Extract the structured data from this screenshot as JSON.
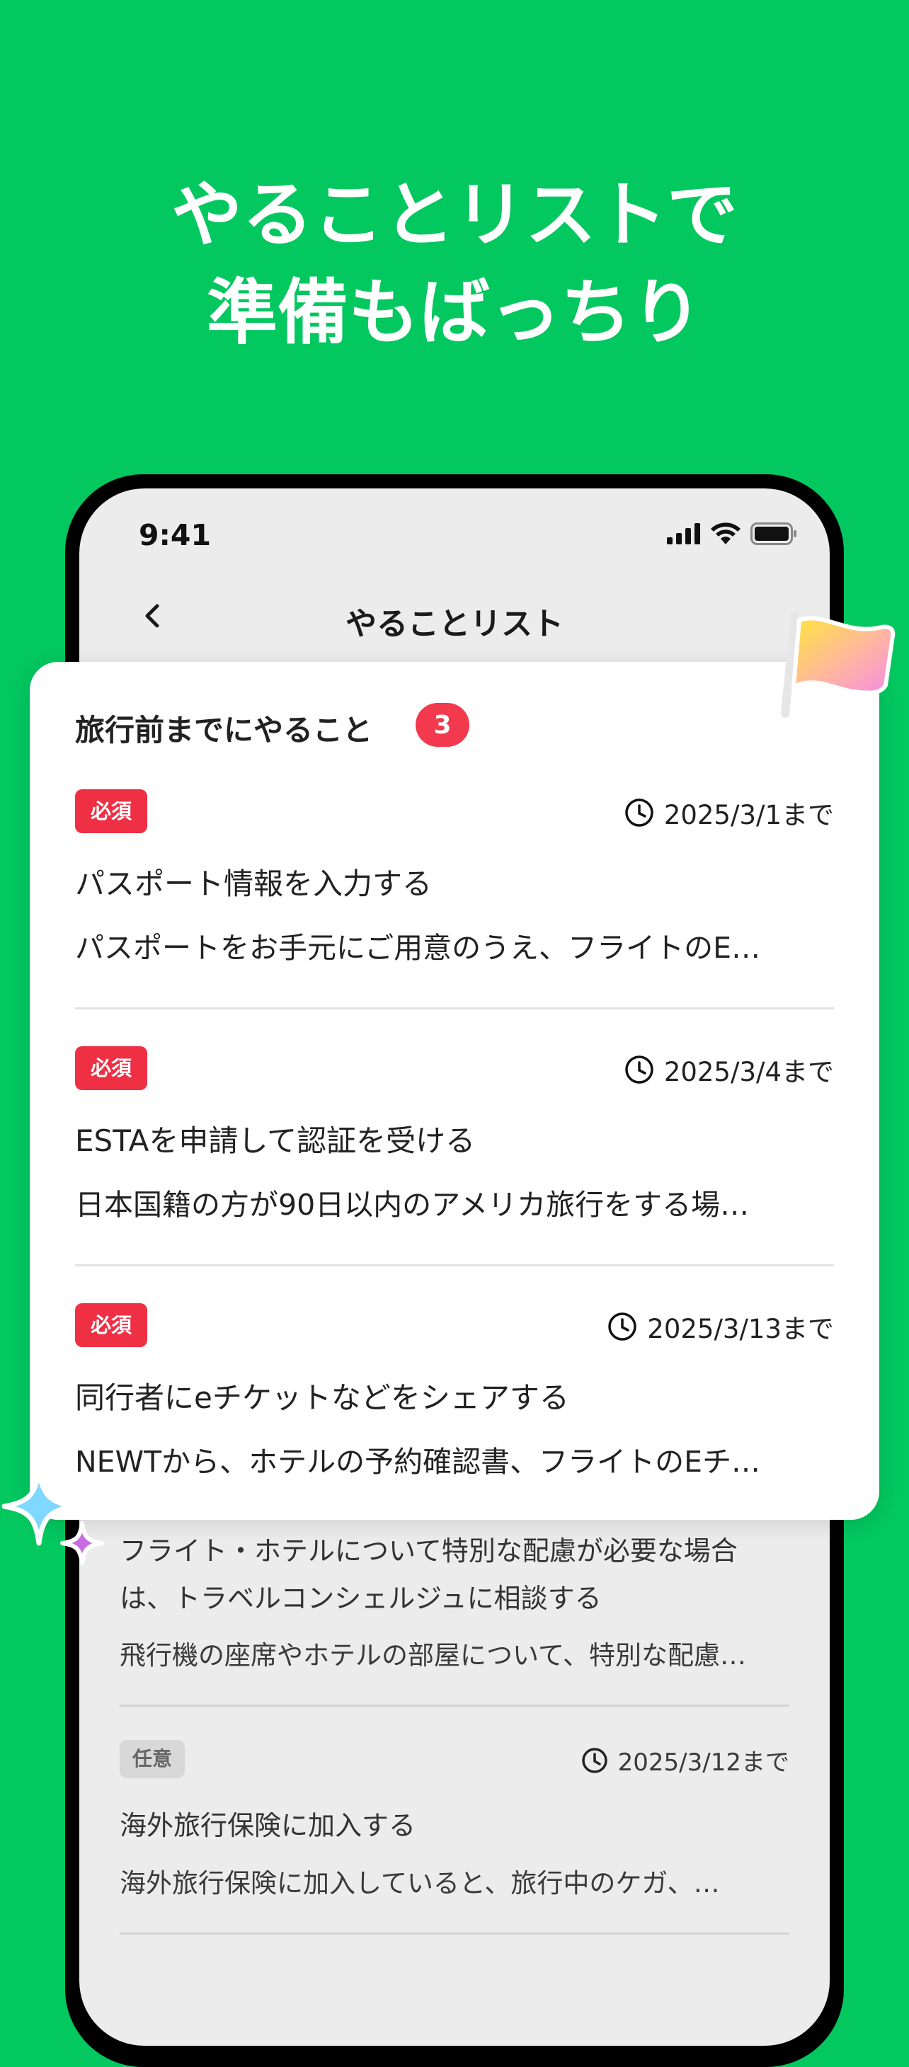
{
  "headline": {
    "line1": "やることリストで",
    "line2": "準備もばっちり"
  },
  "status_bar": {
    "time": "9:41"
  },
  "nav": {
    "title": "やることリスト"
  },
  "card": {
    "title": "旅行前までにやること",
    "count": "3",
    "tasks": [
      {
        "tag": "必須",
        "due": "2025/3/1まで",
        "title": "パスポート情報を入力する",
        "description": "パスポートをお手元にご用意のうえ、フライトのE…"
      },
      {
        "tag": "必須",
        "due": "2025/3/4まで",
        "title": "ESTAを申請して認証を受ける",
        "description": "日本国籍の方が90日以内のアメリカ旅行をする場…"
      },
      {
        "tag": "必須",
        "due": "2025/3/13まで",
        "title": "同行者にeチケットなどをシェアする",
        "description": "NEWTから、ホテルの予約確認書、フライトのEチ…"
      }
    ]
  },
  "background_list": {
    "item1": {
      "title_line1": "フライト・ホテルについて特別な配慮が必要な場合",
      "title_line2": "は、トラベルコンシェルジュに相談する",
      "description": "飛行機の座席やホテルの部屋について、特別な配慮…"
    },
    "item2": {
      "tag": "任意",
      "due": "2025/3/12まで",
      "title": "海外旅行保険に加入する",
      "description": "海外旅行保険に加入していると、旅行中のケガ、…"
    }
  },
  "icons": {
    "back": "chevron-left-icon",
    "clock": "clock-icon",
    "signal": "cellular-signal-icon",
    "wifi": "wifi-icon",
    "battery": "battery-icon",
    "flag": "flag-icon",
    "sparkle": "sparkle-icon"
  },
  "colors": {
    "background_green": "#03c75f",
    "required_red": "#ee2f44",
    "count_badge_red": "#f2394d",
    "optional_gray": "#d8d8d8"
  }
}
